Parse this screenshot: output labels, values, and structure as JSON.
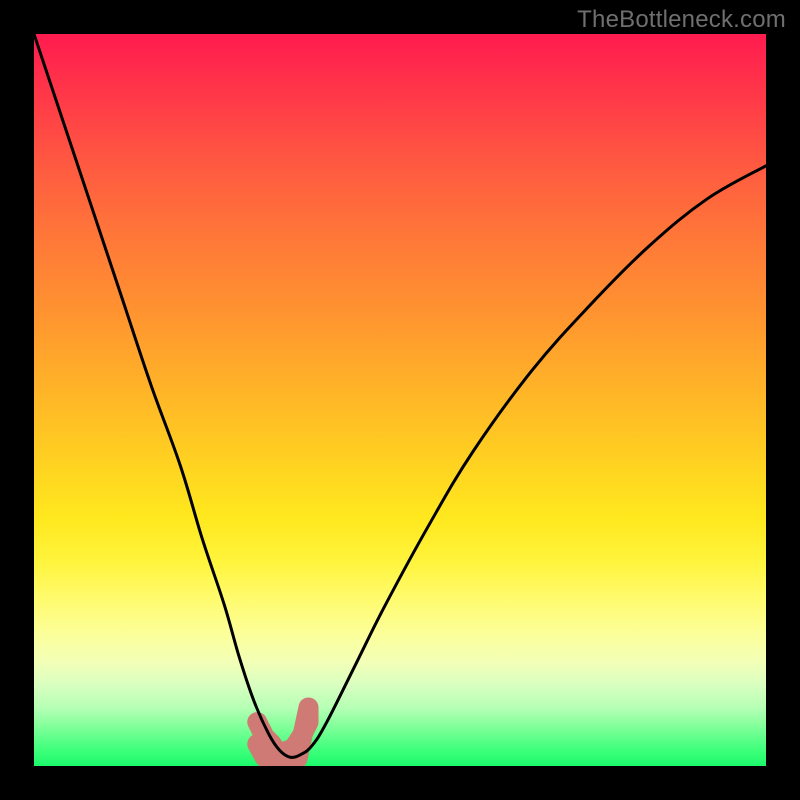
{
  "watermark": "TheBottleneck.com",
  "chart_data": {
    "type": "line",
    "title": "",
    "xlabel": "",
    "ylabel": "",
    "xlim": [
      0,
      100
    ],
    "ylim": [
      0,
      100
    ],
    "grid": false,
    "legend": false,
    "annotations": [],
    "series": [
      {
        "name": "bottleneck-curve",
        "x": [
          0,
          4,
          8,
          12,
          16,
          20,
          23,
          26,
          28,
          30,
          32,
          33.5,
          35,
          36.5,
          38,
          40,
          44,
          48,
          54,
          60,
          68,
          76,
          84,
          92,
          100
        ],
        "y": [
          100,
          88,
          76,
          64,
          52,
          41,
          31,
          22,
          15,
          9,
          4.5,
          2.2,
          1.2,
          1.6,
          2.8,
          6,
          14,
          22,
          33,
          43,
          54,
          63,
          71,
          77.5,
          82
        ],
        "color": "#000000",
        "marker": false
      },
      {
        "name": "overlay-blob",
        "x": [
          30.5,
          31.5,
          32.5,
          33.0,
          34.5,
          35.5,
          36.5,
          37.5,
          37.5,
          36.0,
          34.5,
          33.0,
          31.5,
          30.5
        ],
        "y": [
          6.0,
          4.0,
          3.0,
          2.0,
          2.0,
          2.5,
          4.0,
          6.0,
          8.0,
          1.0,
          0.8,
          0.8,
          1.2,
          3.0
        ],
        "color": "#cf7a74",
        "marker": true
      }
    ],
    "background_gradient": {
      "top_color": "#ff1b4f",
      "mid_color": "#ffe81e",
      "bottom_color": "#1cf96c"
    }
  }
}
